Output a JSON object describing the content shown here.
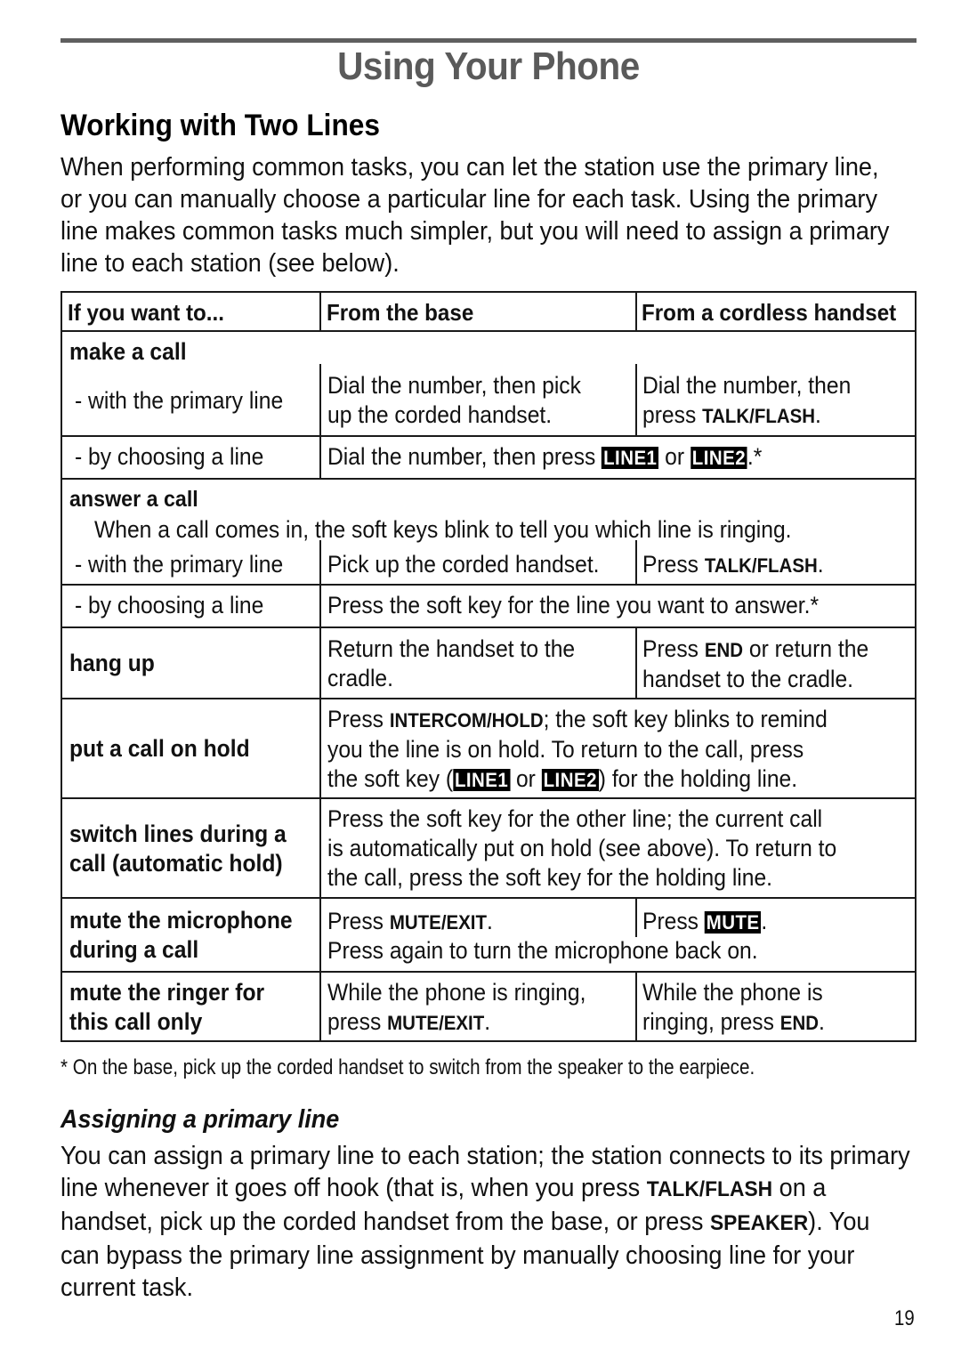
{
  "page": {
    "title": "Using Your Phone",
    "section_title": "Working with Two Lines",
    "intro": "When performing common tasks, you can let the station use the primary line, or you can manually choose a particular line for each task. Using the primary line makes common tasks much simpler, but you will need to assign a primary line to each station (see below).",
    "page_number": "19"
  },
  "table": {
    "headers": [
      "If you want to...",
      "From the base",
      "From a cordless handset"
    ],
    "make_call": {
      "label": "make a call",
      "primary": {
        "label": "- with the primary line",
        "base": [
          "Dial the number, then pick",
          "up the corded handset."
        ],
        "handset_pre": [
          "Dial the number, then",
          "press "
        ],
        "handset_key": "TALK/FLASH",
        "handset_post": "."
      },
      "choose": {
        "label": "- by choosing a line",
        "text_pre": "Dial the number, then press ",
        "key1": "LINE1",
        "or": " or ",
        "key2": "LINE2",
        "text_post": ".*"
      }
    },
    "answer_call": {
      "label": "answer a call",
      "note": "When a call comes in, the soft keys blink to tell you which line is ringing.",
      "primary": {
        "label": "- with the primary line",
        "base": "Pick up the corded handset.",
        "handset_pre": "Press ",
        "handset_key": "TALK/FLASH",
        "handset_post": "."
      },
      "choose": {
        "label": "- by choosing a line",
        "text": "Press the soft key for the line you want to answer.*"
      }
    },
    "hang_up": {
      "label": "hang up",
      "base": [
        "Return the handset to the",
        "cradle."
      ],
      "handset_pre": "Press ",
      "handset_key": "END",
      "handset_post": " or return the",
      "handset_line2": "handset to the cradle."
    },
    "hold": {
      "label": "put a call on hold",
      "l1_pre": "Press ",
      "l1_key": "INTERCOM/HOLD",
      "l1_post": "; the soft key blinks to remind",
      "l2": "you the line is on hold. To return to the call, press",
      "l3_pre": "the soft key (",
      "key1": "LINE1",
      "or": " or ",
      "key2": "LINE2",
      "l3_post": ") for the holding line."
    },
    "switch": {
      "label": [
        "switch lines during a",
        "call (automatic hold)"
      ],
      "text": [
        "Press the soft key for the other line; the current call",
        "is automatically put on hold (see above). To return to",
        "the call, press the soft key for the holding line."
      ]
    },
    "mute_mic": {
      "label": [
        "mute the microphone",
        "during a call"
      ],
      "base_pre": "Press ",
      "base_key": "MUTE/EXIT",
      "base_post": ".",
      "handset_pre": "Press ",
      "handset_key": "MUTE",
      "handset_post": ".",
      "shared": "Press again to turn the microphone back on."
    },
    "mute_ringer": {
      "label": [
        "mute the ringer for",
        "this call only"
      ],
      "base_l1": "While the phone is ringing,",
      "base_pre": "press ",
      "base_key": "MUTE/EXIT",
      "base_post": ".",
      "handset_l1": "While the phone is",
      "handset_pre": "ringing, press ",
      "handset_key": "END",
      "handset_post": "."
    }
  },
  "footnote": "*  On the base, pick up the corded handset to switch from the speaker to the earpiece.",
  "assign": {
    "title": "Assigning a primary line",
    "p1": "You can assign a primary line to each station; the station connects to its primary line whenever it goes off hook (that is, when you press ",
    "key1": "TALK/FLASH",
    "p2": " on a handset, pick up the corded handset from the base, or press ",
    "key2": "SPEAKER",
    "p3": "). You can bypass the primary line assignment by manually choosing line for your current task."
  }
}
